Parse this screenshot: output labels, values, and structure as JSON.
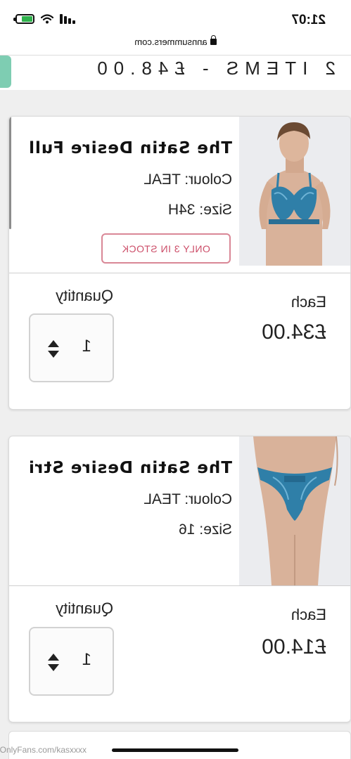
{
  "status_bar": {
    "time": "21:07",
    "battery_level": 0.7,
    "signal_icon": "signal-bars-icon",
    "wifi_icon": "wifi-icon",
    "battery_icon": "battery-charging-icon"
  },
  "browser": {
    "url": "annsummers.com",
    "lock_icon": "lock-icon"
  },
  "basket_summary": {
    "text": "2 ITEMS - £48.00",
    "accent_color": "#7ecdb2"
  },
  "items": [
    {
      "title": "The Satin Desire Full",
      "colour": "Colour: TEAL",
      "size": "Size: 34H",
      "stock_badge": "ONLY 3 IN STOCK",
      "each_label": "Each",
      "price": "£34.00",
      "quantity_label": "Quantity",
      "quantity": "1"
    },
    {
      "title": "The Satin Desire Stri",
      "colour": "Colour: TEAL",
      "size": "Size: 16",
      "each_label": "Each",
      "price": "£14.00",
      "quantity_label": "Quantity",
      "quantity": "1"
    }
  ],
  "watermark": "OnlyFans.com/kasxxxx",
  "colors": {
    "badge": "#cc4d68",
    "product_teal": "#2f7fa8"
  }
}
